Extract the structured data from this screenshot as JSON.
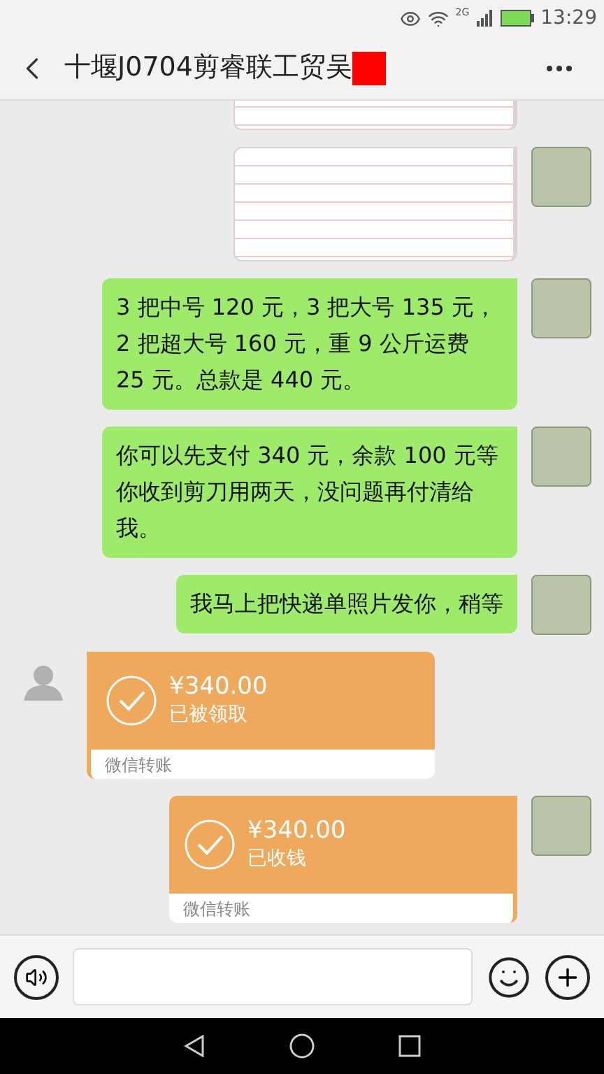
{
  "status_bar": {
    "network": "2G",
    "time": "13:29"
  },
  "header": {
    "title": "十堰J0704剪睿联工贸吴",
    "redacted": true
  },
  "messages": [
    {
      "kind": "image",
      "outgoing": true,
      "avatar_visible": false
    },
    {
      "kind": "image",
      "outgoing": true,
      "avatar_visible": true
    },
    {
      "kind": "text",
      "outgoing": true,
      "avatar_visible": true,
      "text": "3 把中号 120 元，3 把大号 135 元，2 把超大号 160 元，重 9 公斤运费 25 元。总款是 440 元。"
    },
    {
      "kind": "text",
      "outgoing": true,
      "avatar_visible": true,
      "text": "你可以先支付 340 元，余款 100 元等你收到剪刀用两天，没问题再付清给我。"
    },
    {
      "kind": "text",
      "outgoing": true,
      "avatar_visible": true,
      "text": "我马上把快递单照片发你，稍等"
    },
    {
      "kind": "transfer",
      "outgoing": false,
      "avatar_visible": true,
      "amount": "¥340.00",
      "status": "已被领取",
      "footer": "微信转账"
    },
    {
      "kind": "transfer",
      "outgoing": true,
      "avatar_visible": true,
      "amount": "¥340.00",
      "status": "已收钱",
      "footer": "微信转账"
    }
  ]
}
